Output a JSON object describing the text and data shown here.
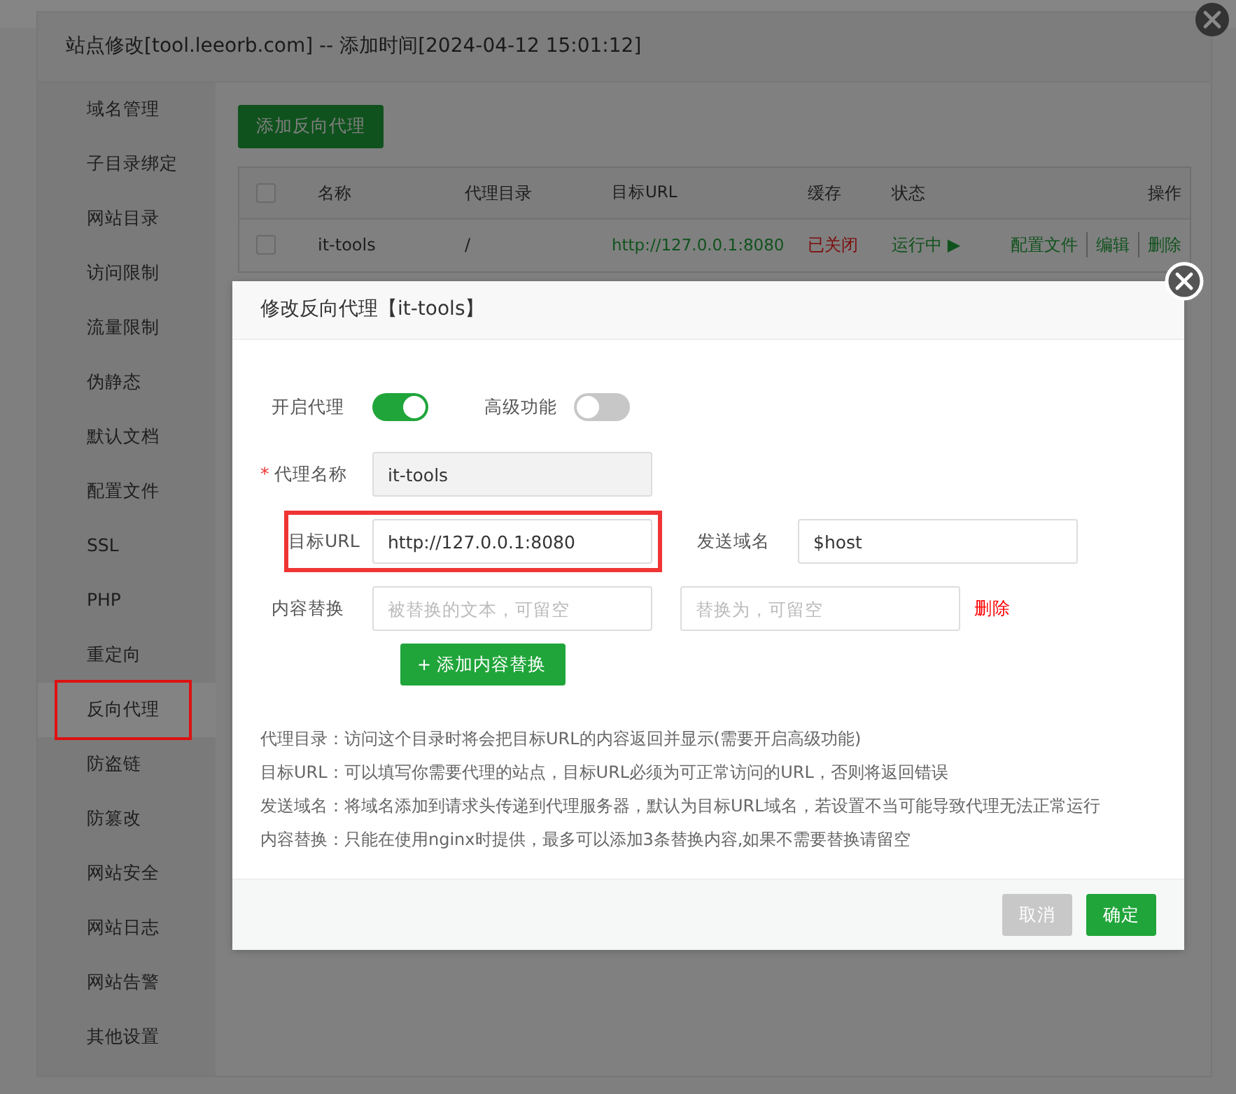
{
  "site_dialog": {
    "title": "站点修改[tool.leeorb.com] -- 添加时间[2024-04-12 15:01:12]",
    "sidebar": {
      "items": [
        {
          "label": "域名管理",
          "selected": false
        },
        {
          "label": "子目录绑定",
          "selected": false
        },
        {
          "label": "网站目录",
          "selected": false
        },
        {
          "label": "访问限制",
          "selected": false
        },
        {
          "label": "流量限制",
          "selected": false
        },
        {
          "label": "伪静态",
          "selected": false
        },
        {
          "label": "默认文档",
          "selected": false
        },
        {
          "label": "配置文件",
          "selected": false
        },
        {
          "label": "SSL",
          "selected": false
        },
        {
          "label": "PHP",
          "selected": false
        },
        {
          "label": "重定向",
          "selected": false
        },
        {
          "label": "反向代理",
          "selected": true
        },
        {
          "label": "防盗链",
          "selected": false
        },
        {
          "label": "防篡改",
          "selected": false
        },
        {
          "label": "网站安全",
          "selected": false
        },
        {
          "label": "网站日志",
          "selected": false
        },
        {
          "label": "网站告警",
          "selected": false
        },
        {
          "label": "其他设置",
          "selected": false
        }
      ]
    },
    "add_button": "添加反向代理",
    "table": {
      "select_all_checked": false,
      "columns": [
        "名称",
        "代理目录",
        "目标URL",
        "缓存",
        "状态",
        "操作"
      ],
      "rows": [
        {
          "checked": false,
          "name": "it-tools",
          "directory": "/",
          "target_url": "http://127.0.0.1:8080",
          "cache": "已关闭",
          "status": "运行中 ▶",
          "actions": [
            "配置文件",
            "编辑",
            "删除"
          ]
        }
      ]
    }
  },
  "proxy_dialog": {
    "title": "修改反向代理【it-tools】",
    "rows": [
      {
        "label": "开启代理",
        "highlighted": false,
        "items": [
          {
            "kind": "toggle",
            "on": true
          },
          {
            "kind": "label",
            "text": "高级功能"
          },
          {
            "kind": "toggle",
            "on": false
          }
        ]
      },
      {
        "marker": "*",
        "label": "代理名称",
        "highlighted": false,
        "items": [
          {
            "kind": "input",
            "value": "it-tools",
            "readonly": true
          }
        ]
      },
      {
        "label": "目标URL",
        "highlighted": true,
        "items": [
          {
            "kind": "input",
            "value": "http://127.0.0.1:8080",
            "readonly": false
          },
          {
            "kind": "label",
            "text": "发送域名"
          },
          {
            "kind": "input",
            "value": "$host",
            "readonly": false
          }
        ]
      },
      {
        "label": "内容替换",
        "highlighted": false,
        "items": [
          {
            "kind": "input",
            "placeholder": "被替换的文本，可留空",
            "readonly": false
          },
          {
            "kind": "input",
            "placeholder": "替换为，可留空",
            "readonly": false
          },
          {
            "kind": "link",
            "text": "删除"
          }
        ]
      }
    ],
    "add_replace_button": {
      "icon": "+",
      "label": "添加内容替换"
    },
    "notes": [
      "代理目录：访问这个目录时将会把目标URL的内容返回并显示(需要开启高级功能)",
      "目标URL：可以填写你需要代理的站点，目标URL必须为可正常访问的URL，否则将返回错误",
      "发送域名：将域名添加到请求头传递到代理服务器，默认为目标URL域名，若设置不当可能导致代理无法正常运行",
      "内容替换：只能在使用nginx时提供，最多可以添加3条替换内容,如果不需要替换请留空"
    ],
    "buttons": [
      {
        "label": "取消",
        "kind": "cancel"
      },
      {
        "label": "确定",
        "kind": "primary"
      }
    ]
  }
}
